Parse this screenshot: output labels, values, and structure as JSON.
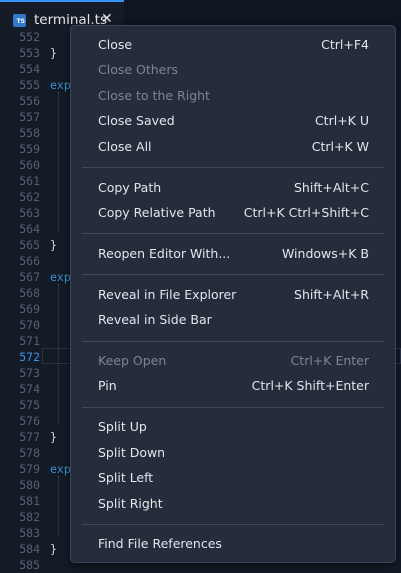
{
  "tab": {
    "icon": "typescript-file-icon",
    "icon_text": "TS",
    "title": "terminal.ts",
    "close": "✕",
    "accent": "#3794ff"
  },
  "editor": {
    "current_line": "572",
    "lines": [
      {
        "n": "552",
        "text": ""
      },
      {
        "n": "553",
        "text": "}"
      },
      {
        "n": "554",
        "text": ""
      },
      {
        "n": "555",
        "text": "exp",
        "keyword": true
      },
      {
        "n": "556",
        "text": ""
      },
      {
        "n": "557",
        "text": ""
      },
      {
        "n": "558",
        "text": ""
      },
      {
        "n": "559",
        "text": ""
      },
      {
        "n": "560",
        "text": ""
      },
      {
        "n": "561",
        "text": ""
      },
      {
        "n": "562",
        "text": ""
      },
      {
        "n": "563",
        "text": ""
      },
      {
        "n": "564",
        "text": ""
      },
      {
        "n": "565",
        "text": "}"
      },
      {
        "n": "566",
        "text": ""
      },
      {
        "n": "567",
        "text": "exp",
        "keyword": true
      },
      {
        "n": "568",
        "text": ""
      },
      {
        "n": "569",
        "text": ""
      },
      {
        "n": "570",
        "text": ""
      },
      {
        "n": "571",
        "text": ""
      },
      {
        "n": "572",
        "text": ""
      },
      {
        "n": "573",
        "text": ""
      },
      {
        "n": "574",
        "text": ""
      },
      {
        "n": "575",
        "text": ""
      },
      {
        "n": "576",
        "text": ""
      },
      {
        "n": "577",
        "text": "}"
      },
      {
        "n": "578",
        "text": ""
      },
      {
        "n": "579",
        "text": "exp",
        "keyword": true
      },
      {
        "n": "580",
        "text": ""
      },
      {
        "n": "581",
        "text": ""
      },
      {
        "n": "582",
        "text": ""
      },
      {
        "n": "583",
        "text": ""
      },
      {
        "n": "584",
        "text": "}"
      },
      {
        "n": "585",
        "text": ""
      }
    ]
  },
  "menu": {
    "groups": [
      [
        {
          "label": "Close",
          "shortcut": "Ctrl+F4",
          "enabled": true
        },
        {
          "label": "Close Others",
          "shortcut": "",
          "enabled": false
        },
        {
          "label": "Close to the Right",
          "shortcut": "",
          "enabled": false
        },
        {
          "label": "Close Saved",
          "shortcut": "Ctrl+K U",
          "enabled": true
        },
        {
          "label": "Close All",
          "shortcut": "Ctrl+K W",
          "enabled": true
        }
      ],
      [
        {
          "label": "Copy Path",
          "shortcut": "Shift+Alt+C",
          "enabled": true
        },
        {
          "label": "Copy Relative Path",
          "shortcut": "Ctrl+K Ctrl+Shift+C",
          "enabled": true
        }
      ],
      [
        {
          "label": "Reopen Editor With...",
          "shortcut": "Windows+K B",
          "enabled": true
        }
      ],
      [
        {
          "label": "Reveal in File Explorer",
          "shortcut": "Shift+Alt+R",
          "enabled": true
        },
        {
          "label": "Reveal in Side Bar",
          "shortcut": "",
          "enabled": true
        }
      ],
      [
        {
          "label": "Keep Open",
          "shortcut": "Ctrl+K Enter",
          "enabled": false
        },
        {
          "label": "Pin",
          "shortcut": "Ctrl+K Shift+Enter",
          "enabled": true
        }
      ],
      [
        {
          "label": "Split Up",
          "shortcut": "",
          "enabled": true
        },
        {
          "label": "Split Down",
          "shortcut": "",
          "enabled": true
        },
        {
          "label": "Split Left",
          "shortcut": "",
          "enabled": true
        },
        {
          "label": "Split Right",
          "shortcut": "",
          "enabled": true
        }
      ],
      [
        {
          "label": "Find File References",
          "shortcut": "",
          "enabled": true
        }
      ]
    ]
  }
}
